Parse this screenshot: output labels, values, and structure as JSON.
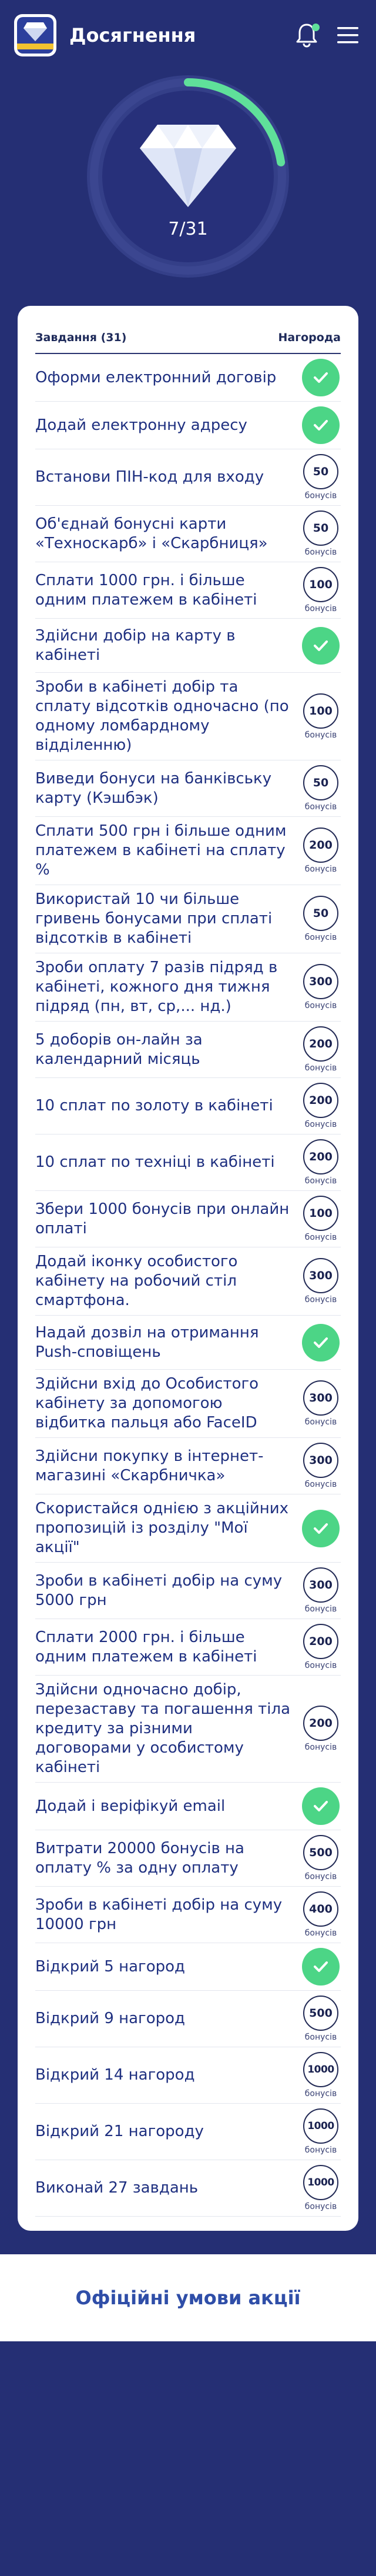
{
  "header": {
    "title": "Досягнення",
    "logo_icon": "logo-icon",
    "bell_icon": "bell-icon",
    "menu_icon": "menu-icon"
  },
  "progress": {
    "label": "7/31",
    "completed": 7,
    "total": 31,
    "icon": "diamond-icon",
    "accent": "#5fe09a"
  },
  "tasks": {
    "header_label": "Завдання (31)",
    "reward_label": "Нагорода",
    "bonus_unit": "бонусів",
    "items": [
      {
        "text": "Оформи електронний договір",
        "done": true,
        "reward": ""
      },
      {
        "text": "Додай електронну адресу",
        "done": true,
        "reward": ""
      },
      {
        "text": "Встанови ПІН-код для входу",
        "done": false,
        "reward": "50"
      },
      {
        "text": "Об'єднай бонусні карти «Техноскарб» і «Скарбниця»",
        "done": false,
        "reward": "50"
      },
      {
        "text": "Сплати 1000 грн. і більше одним платежем в кабінеті",
        "done": false,
        "reward": "100"
      },
      {
        "text": "Здійсни добір на карту в кабінеті",
        "done": true,
        "reward": ""
      },
      {
        "text": "Зроби в кабінеті добір та сплату відсотків одночасно (по одному ломбардному відділенню)",
        "done": false,
        "reward": "100"
      },
      {
        "text": "Виведи бонуси на банківську карту (Кэшбэк)",
        "done": false,
        "reward": "50"
      },
      {
        "text": "Сплати 500 грн і більше одним платежем в кабінеті на сплату %",
        "done": false,
        "reward": "200"
      },
      {
        "text": "Використай 10 чи більше гривень бонусами при сплаті відсотків в кабінеті",
        "done": false,
        "reward": "50"
      },
      {
        "text": "Зроби оплату 7 разів підряд в кабінеті, кожного дня тижня підряд (пн, вт, ср,... нд.)",
        "done": false,
        "reward": "300"
      },
      {
        "text": "5 доборів он-лайн за календарний місяць",
        "done": false,
        "reward": "200"
      },
      {
        "text": "10 сплат по золоту в кабінеті",
        "done": false,
        "reward": "200"
      },
      {
        "text": "10 сплат по техніці в кабінеті",
        "done": false,
        "reward": "200"
      },
      {
        "text": "Збери 1000 бонусів при онлайн оплаті",
        "done": false,
        "reward": "100"
      },
      {
        "text": "Додай іконку особистого кабінету на робочий стіл смартфона.",
        "done": false,
        "reward": "300"
      },
      {
        "text": "Надай дозвіл на отримання Push-сповіщень",
        "done": true,
        "reward": ""
      },
      {
        "text": "Здійсни вхід до Особистого кабінету за допомогою відбитка пальця або FaceID",
        "done": false,
        "reward": "300"
      },
      {
        "text": "Здійсни покупку в інтернет-магазині «Скарбничка»",
        "done": false,
        "reward": "300"
      },
      {
        "text": "Скористайся однією з акційних пропозицій із розділу \"Мої акції\"",
        "done": true,
        "reward": ""
      },
      {
        "text": "Зроби в кабінеті добір на суму 5000 грн",
        "done": false,
        "reward": "300"
      },
      {
        "text": "Сплати 2000 грн. і більше одним платежем в кабінеті",
        "done": false,
        "reward": "200"
      },
      {
        "text": "Здійсни одночасно добір, перезаставу та погашення тіла кредиту за різними договорами у особистому кабінеті",
        "done": false,
        "reward": "200"
      },
      {
        "text": "Додай і веріфікуй email",
        "done": true,
        "reward": ""
      },
      {
        "text": "Витрати 20000 бонусів на оплату % за одну оплату",
        "done": false,
        "reward": "500"
      },
      {
        "text": "Зроби в кабінеті добір на суму 10000 грн",
        "done": false,
        "reward": "400"
      },
      {
        "text": "Відкрий 5 нагород",
        "done": true,
        "reward": ""
      },
      {
        "text": "Відкрий 9 нагород",
        "done": false,
        "reward": "500"
      },
      {
        "text": "Відкрий 14 нагород",
        "done": false,
        "reward": "1000"
      },
      {
        "text": "Відкрий 21 нагороду",
        "done": false,
        "reward": "1000"
      },
      {
        "text": "Виконай 27 завдань",
        "done": false,
        "reward": "1000"
      }
    ]
  },
  "footer": {
    "link_label": "Офіційні умови акції"
  }
}
